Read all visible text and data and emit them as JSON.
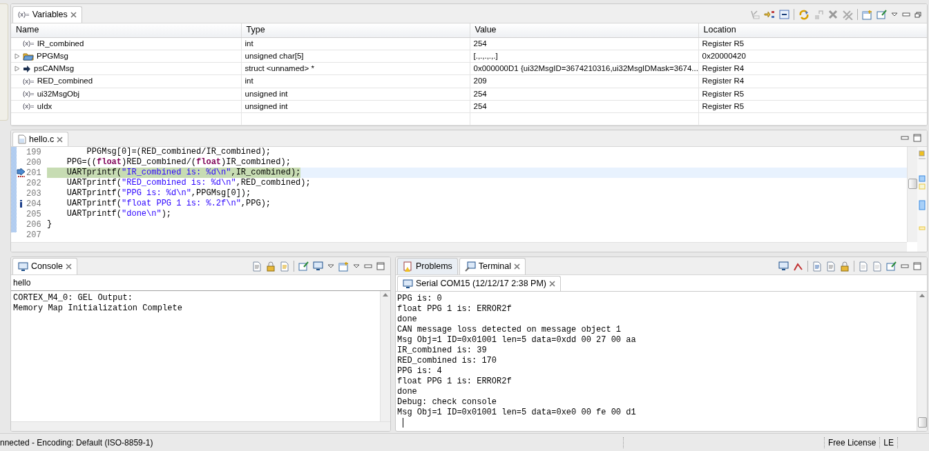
{
  "variables_view": {
    "tab": {
      "icon": "(x)=",
      "label": "Variables"
    },
    "columns": [
      "Name",
      "Type",
      "Value",
      "Location"
    ],
    "rows": [
      {
        "kind": "variable",
        "icon": "(x)=",
        "expandable": false,
        "name": "IR_combined",
        "type": "int",
        "value": "254",
        "location": "Register R5"
      },
      {
        "kind": "array",
        "expandable": true,
        "name": "PPGMsg",
        "type": "unsigned char[5]",
        "value": "[.,.,.,.,.]",
        "location": "0x20000420"
      },
      {
        "kind": "pointer",
        "expandable": true,
        "name": "psCANMsg",
        "type": "struct <unnamed> *",
        "value": "0x000000D1 {ui32MsgID=3674210316,ui32MsgIDMask=3674...",
        "location": "Register R4"
      },
      {
        "kind": "variable",
        "icon": "(x)=",
        "expandable": false,
        "name": "RED_combined",
        "type": "int",
        "value": "209",
        "location": "Register R4"
      },
      {
        "kind": "variable",
        "icon": "(x)=",
        "expandable": false,
        "name": "ui32MsgObj",
        "type": "unsigned int",
        "value": "254",
        "location": "Register R5"
      },
      {
        "kind": "variable",
        "icon": "(x)=",
        "expandable": false,
        "name": "uIdx",
        "type": "unsigned int",
        "value": "254",
        "location": "Register R5"
      }
    ]
  },
  "editor": {
    "tab": {
      "label": "hello.c"
    },
    "lines": [
      {
        "number": "199",
        "current": false,
        "annotation": false,
        "tokens": [
          {
            "kind": "plain",
            "text": "        PPGMsg[0]=(RED_combined/IR_combined);"
          }
        ]
      },
      {
        "number": "200",
        "current": false,
        "annotation": false,
        "tokens": [
          {
            "kind": "plain",
            "text": "    PPG=(("
          },
          {
            "kind": "keyword",
            "text": "float"
          },
          {
            "kind": "plain",
            "text": ")RED_combined/("
          },
          {
            "kind": "keyword",
            "text": "float"
          },
          {
            "kind": "plain",
            "text": ")IR_combined);"
          }
        ]
      },
      {
        "number": "201",
        "current": true,
        "annotation": false,
        "tokens": [
          {
            "kind": "plain",
            "text": "    UARTprintf("
          },
          {
            "kind": "string",
            "text": "\"IR_combined is: %d\\n\""
          },
          {
            "kind": "plain",
            "text": ",IR_combined);"
          }
        ]
      },
      {
        "number": "202",
        "current": false,
        "annotation": false,
        "tokens": [
          {
            "kind": "plain",
            "text": "    UARTprintf("
          },
          {
            "kind": "string",
            "text": "\"RED_combined is: %d\\n\""
          },
          {
            "kind": "plain",
            "text": ",RED_combined);"
          }
        ]
      },
      {
        "number": "203",
        "current": false,
        "annotation": false,
        "tokens": [
          {
            "kind": "plain",
            "text": "    UARTprintf("
          },
          {
            "kind": "string",
            "text": "\"PPG is: %d\\n\""
          },
          {
            "kind": "plain",
            "text": ",PPGMsg[0]);"
          }
        ]
      },
      {
        "number": "204",
        "current": false,
        "annotation": true,
        "tokens": [
          {
            "kind": "plain",
            "text": "    UARTprintf("
          },
          {
            "kind": "string",
            "text": "\"float PPG 1 is: %.2f\\n\""
          },
          {
            "kind": "plain",
            "text": ",PPG);"
          }
        ]
      },
      {
        "number": "205",
        "current": false,
        "annotation": false,
        "tokens": [
          {
            "kind": "plain",
            "text": "    UARTprintf("
          },
          {
            "kind": "string",
            "text": "\"done\\n\""
          },
          {
            "kind": "plain",
            "text": ");"
          }
        ]
      },
      {
        "number": "206",
        "current": false,
        "annotation": false,
        "tokens": [
          {
            "kind": "plain",
            "text": "}"
          }
        ]
      },
      {
        "number": "207",
        "current": false,
        "annotation": false
      }
    ]
  },
  "console": {
    "tab": {
      "label": "Console"
    },
    "title": "hello",
    "lines": [
      "CORTEX_M4_0: GEL Output:",
      "Memory Map Initialization Complete"
    ]
  },
  "terminal_panel": {
    "tabs": [
      {
        "label": "Problems",
        "selected": false
      },
      {
        "label": "Terminal",
        "selected": true
      }
    ],
    "session_tab": {
      "label": "Serial COM15 (12/12/17 2:38 PM)"
    },
    "lines": [
      "PPG is: 0",
      "float PPG 1 is: ERROR2f",
      "done",
      "CAN message loss detected on message object 1",
      "Msg Obj=1 ID=0x01001 len=5 data=0xdd 00 27 00 aa",
      "IR_combined is: 39",
      "RED_combined is: 170",
      "PPG is: 4",
      "float PPG 1 is: ERROR2f",
      "done",
      "Debug: check console",
      "Msg Obj=1 ID=0x01001 len=5 data=0xe0 00 fe 00 d1"
    ]
  },
  "status_bar": {
    "message": "nnected - Encoding: Default (ISO-8859-1)",
    "license": "Free License",
    "byte_order": "LE"
  }
}
